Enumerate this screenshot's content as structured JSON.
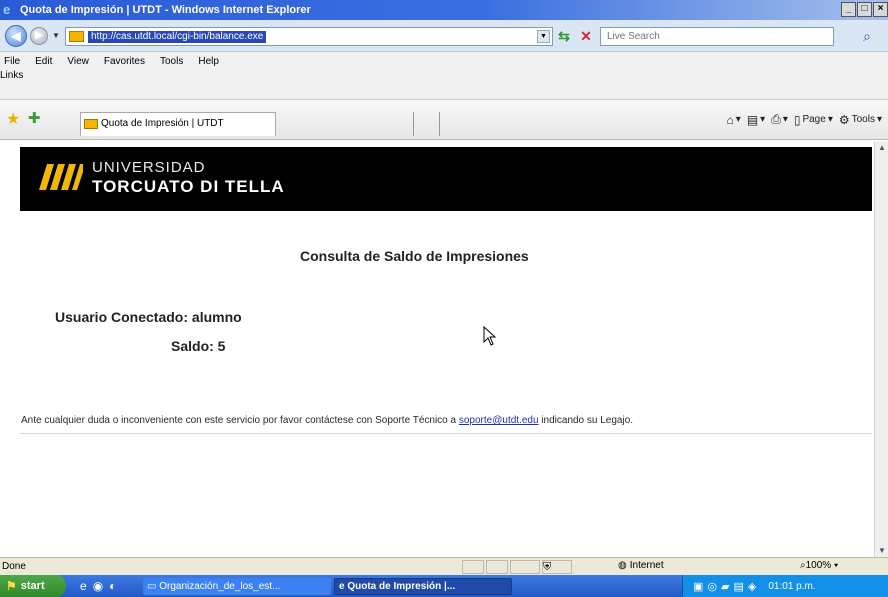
{
  "window": {
    "title": "Quota de Impresión | UTDT - Windows Internet Explorer",
    "controls": [
      "_",
      "□",
      "×"
    ]
  },
  "address_bar": {
    "url": "http://cas.utdt.local/cgi-bin/balance.exe",
    "search_placeholder": "Live Search"
  },
  "menu": {
    "items": [
      "File",
      "Edit",
      "View",
      "Favorites",
      "Tools",
      "Help"
    ],
    "links_label": "Links"
  },
  "tab": {
    "label": "Quota de Impresión | UTDT"
  },
  "command_bar": {
    "page_label": "Page",
    "tools_label": "Tools"
  },
  "page": {
    "logo_line1": "UNIVERSIDAD",
    "logo_line2": "TORCUATO DI TELLA",
    "heading": "Consulta de Saldo de Impresiones",
    "user_line": "Usuario Conectado: alumno",
    "balance_line": "Saldo: 5",
    "help_prefix": "Ante cualquier duda o inconveniente con este servicio por favor contáctese con Soporte Técnico a ",
    "help_email": "soporte@utdt.edu",
    "help_suffix": " indicando su Legajo."
  },
  "status_bar": {
    "status": "Done",
    "zone": "Internet",
    "zoom": "100%"
  },
  "taskbar": {
    "start_label": "start",
    "items": [
      "Organización_de_los_est...",
      "Quota de Impresión |..."
    ],
    "clock": "01:01 p.m."
  },
  "colors": {
    "titlebar": "#2a5bd7",
    "header_band": "#000000",
    "logo_yellow": "#f2b705",
    "link": "#2030b0"
  }
}
